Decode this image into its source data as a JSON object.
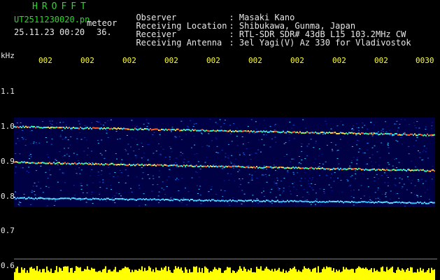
{
  "header": {
    "brand": "HROFFT",
    "filename": "UT2511230020.pn",
    "type": "meteor",
    "datetime": "25.11.23 00:20",
    "count": "36.",
    "meta": [
      {
        "label": "Observer",
        "value": ": Masaki Kano"
      },
      {
        "label": "Receiving Location",
        "value": ": Shibukawa, Gunma, Japan"
      },
      {
        "label": "Receiver",
        "value": ": RTL-SDR SDR# 43dB L15 103.2MHz CW"
      },
      {
        "label": "Receiving Antenna",
        "value": ": 3el Yagi(V) Az 330 for Vladivostok"
      }
    ]
  },
  "axis": {
    "unit": "kHz",
    "time_ticks": [
      "002",
      "002",
      "002",
      "002",
      "002",
      "002",
      "002",
      "002",
      "002",
      "0030"
    ],
    "freq_ticks": [
      "1.1",
      "1.0",
      "0.9",
      "0.8",
      "0.7",
      "0.6"
    ]
  },
  "colors": {
    "background": "#000000",
    "brand": "#22dd22",
    "text": "#e8e8e8",
    "ticks": "#ffff33",
    "noise_bar": "#ffff00",
    "spectrogram_base": "#000044"
  }
}
